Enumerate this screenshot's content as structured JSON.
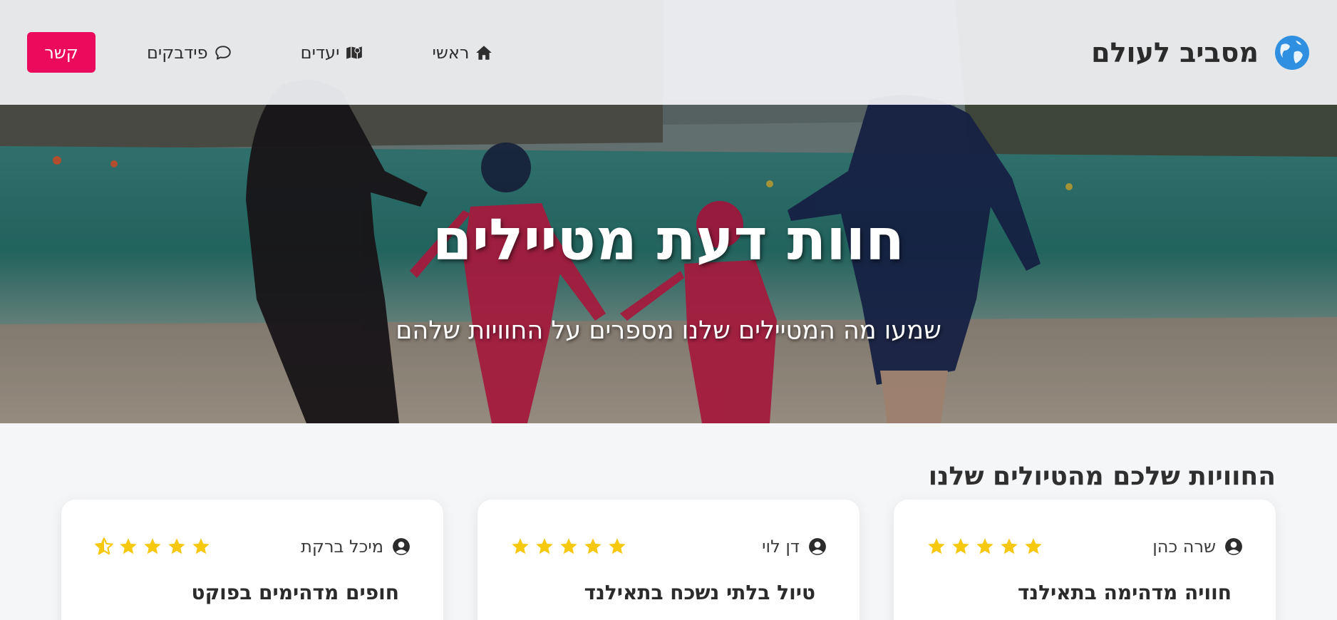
{
  "brand": {
    "name": "מסביב לעולם",
    "logo_icon": "globe-icon",
    "accent": "#2f8fe0"
  },
  "nav": {
    "home_label": "ראשי",
    "destinations_label": "יעדים",
    "feedback_label": "פידבקים",
    "contact_label": "קשר",
    "contact_color": "#ec0a5c"
  },
  "hero": {
    "title": "חוות דעת מטיילים",
    "subtitle": "שמעו מה המטיילים שלנו מספרים על החוויות שלהם"
  },
  "reviews_section": {
    "title": "החוויות שלכם מהטיולים שלנו",
    "star_color": "#f6c90e",
    "reviews": [
      {
        "author": "שרה כהן",
        "rating": 5,
        "title": "חוויה מדהימה בתאילנד"
      },
      {
        "author": "דן לוי",
        "rating": 5,
        "title": "טיול בלתי נשכח בתאילנד"
      },
      {
        "author": "מיכל ברקת",
        "rating": 4.5,
        "title": "חופים מדהימים בפוקט"
      }
    ]
  }
}
